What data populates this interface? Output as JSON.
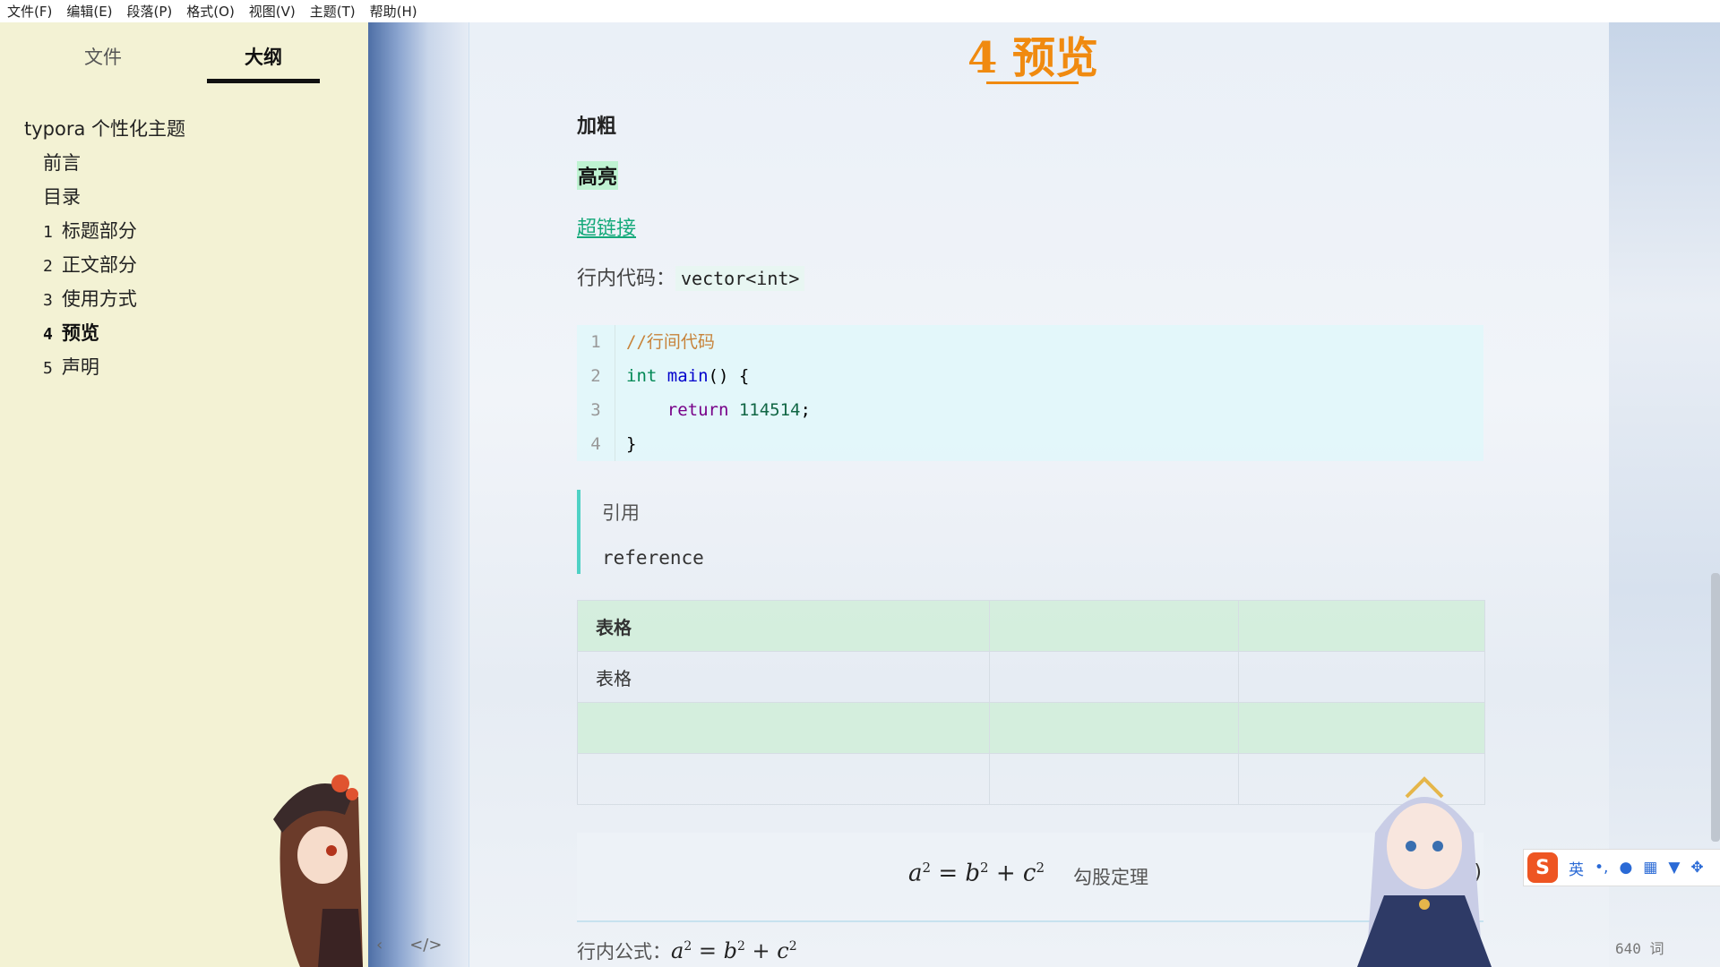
{
  "menu": [
    "文件(F)",
    "编辑(E)",
    "段落(P)",
    "格式(O)",
    "视图(V)",
    "主题(T)",
    "帮助(H)"
  ],
  "sidebar": {
    "tabs": {
      "files": "文件",
      "outline": "大纲"
    },
    "outline": [
      {
        "num": "",
        "label": "typora 个性化主题",
        "level": 1
      },
      {
        "num": "",
        "label": "前言",
        "level": 2
      },
      {
        "num": "",
        "label": "目录",
        "level": 2
      },
      {
        "num": "1",
        "label": "标题部分",
        "level": 2
      },
      {
        "num": "2",
        "label": "正文部分",
        "level": 2
      },
      {
        "num": "3",
        "label": "使用方式",
        "level": 2
      },
      {
        "num": "4",
        "label": "预览",
        "level": 2,
        "active": true
      },
      {
        "num": "5",
        "label": "声明",
        "level": 2
      }
    ],
    "footer": {
      "back_icon": "‹",
      "source_icon": "</>"
    }
  },
  "document": {
    "heading": "4 预览",
    "bold": "加粗",
    "highlight": "高亮",
    "link": "超链接",
    "inline_code_label": "行内代码：",
    "inline_code": "vector<int>",
    "code_lines": [
      {
        "n": "1"
      },
      {
        "n": "2"
      },
      {
        "n": "3"
      },
      {
        "n": "4"
      }
    ],
    "code": {
      "comment": "//行间代码",
      "kw_int": "int",
      "fn_main": "main",
      "after_main": "() {",
      "kw_return": "return",
      "num": "114514",
      "semi": ";",
      "close": "}"
    },
    "quote": {
      "line1": "引用",
      "line2": "reference"
    },
    "table": {
      "r1c1": "表格",
      "r2c1": "表格"
    },
    "math": {
      "a": "a",
      "b": "b",
      "c": "c",
      "exp": "2",
      "eq": " = ",
      "plus": " + ",
      "note": "勾股定理",
      "tag": "(1)"
    },
    "inline_math_label": "行内公式："
  },
  "status": {
    "word_count": "640 词"
  },
  "ime": {
    "lang": "英",
    "punct": "•,"
  },
  "colors": {
    "heading": "#f08a10",
    "highlight": "#bff3d2",
    "link": "#15a97a",
    "quote_bar": "#4fd1c5",
    "sidebar_bg": "#f3f2d4"
  }
}
